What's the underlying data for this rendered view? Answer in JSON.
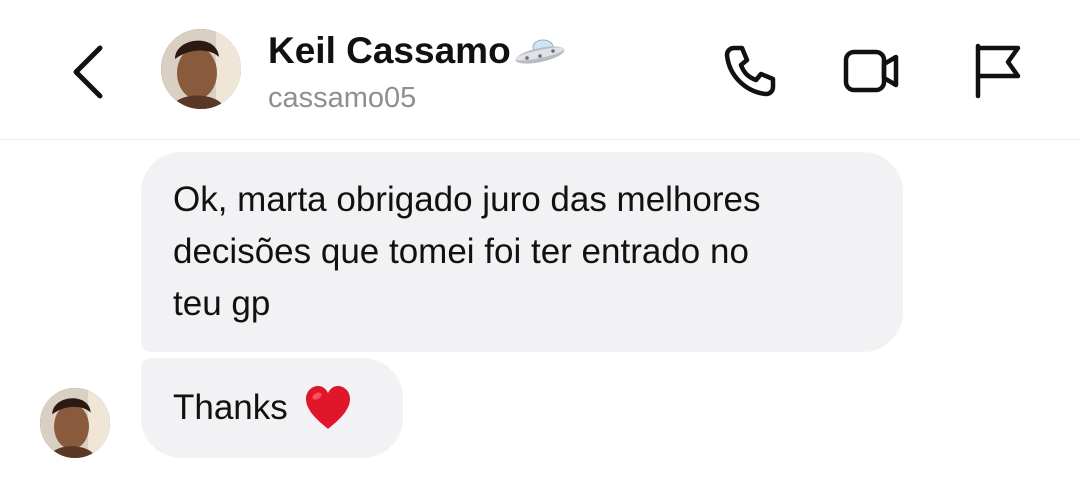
{
  "header": {
    "back_icon": "chevron-left-icon",
    "contact_name": "Keil Cassamo",
    "name_emoji": "ufo-icon",
    "username": "cassamo05",
    "actions": [
      {
        "name": "call",
        "icon": "phone-icon"
      },
      {
        "name": "video",
        "icon": "video-camera-icon"
      },
      {
        "name": "report",
        "icon": "flag-icon"
      }
    ]
  },
  "messages": [
    {
      "lines": [
        "Ok, marta obrigado juro das melhores",
        "decisões que tomei foi ter entrado no",
        "teu gp"
      ]
    },
    {
      "text": "Thanks",
      "emoji": "red-heart-icon"
    }
  ],
  "colors": {
    "bubble": "#f2f2f4",
    "username": "#8e8e93",
    "text": "#111111",
    "heart": "#e0162b"
  }
}
